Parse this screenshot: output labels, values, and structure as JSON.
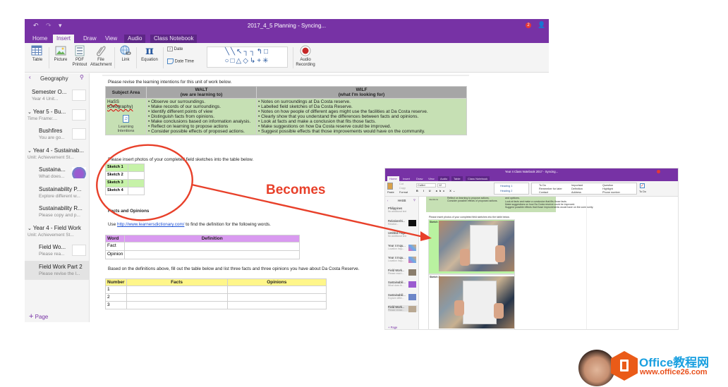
{
  "window": {
    "title": "2017_4_5 Planning - Syncing...",
    "quick_access": [
      "undo-icon",
      "redo-icon",
      "customize-icon"
    ],
    "notification_count": "2"
  },
  "tabs": [
    {
      "label": "Home",
      "active": false
    },
    {
      "label": "Insert",
      "active": true
    },
    {
      "label": "Draw",
      "active": false
    },
    {
      "label": "View",
      "active": false
    },
    {
      "label": "Audio",
      "active": false
    },
    {
      "label": "Class Notebook",
      "active": false
    }
  ],
  "ribbon": {
    "table": "Table",
    "picture": "Picture",
    "pdf_printout": "PDF Printout",
    "file_attachment": "File Attachment",
    "link": "Link",
    "equation": "Equation",
    "date": "Date",
    "date_time": "Date  Time",
    "shapes_row1": "╲╲↖┐┐↰□",
    "shapes_row2": "○□△◇↳+✳",
    "audio_recording": "Audio Recording"
  },
  "sidebar": {
    "section": "Geography",
    "items": [
      {
        "title": "Semester O...",
        "sub": "Year 4  Unit...",
        "level": 0,
        "thumb": true
      },
      {
        "title": "Year 5 - Bu...",
        "sub": "Time Frame:...",
        "level": 0,
        "group": true,
        "thumb": true
      },
      {
        "title": "Bushfires",
        "sub": "You are go...",
        "level": 1,
        "thumb": true
      },
      {
        "title": "Year 4 - Sustainab...",
        "sub": "Unit:  Achievement St...",
        "level": 0,
        "group": true
      },
      {
        "title": "Sustaina...",
        "sub": "What does...",
        "level": 1,
        "thumb": true
      },
      {
        "title": "Sustainability P...",
        "sub": "Explore different w...",
        "level": 1
      },
      {
        "title": "Sustainability R...",
        "sub": "Please copy and p...",
        "level": 1
      },
      {
        "title": "Year 4 - Field Work",
        "sub": "Unit:  Achievement St...",
        "level": 0,
        "group": true
      },
      {
        "title": "Field Wo...",
        "sub": "Please rea...",
        "level": 1,
        "thumb": true
      },
      {
        "title": "Field Work Part 2",
        "sub": "Please revise the l...",
        "level": 1,
        "selected": true
      }
    ],
    "add_page": "Page"
  },
  "page": {
    "intro": "Please revise the learning intentions for this unit of work below.",
    "learning_table": {
      "headers": [
        "Subject Area",
        "WALT",
        "(we are learning to)",
        "WILF",
        "(what I'm looking for)"
      ],
      "subject": "HaSS (Geography)",
      "attachment_label": "Learning Intentions",
      "walt": [
        "Observe our surroundings.",
        "Make records of our surroundings.",
        "Identify different points of view",
        "Distinguish facts from opinions.",
        "Make conclusions based on information analysis.",
        "Reflect on learning to propose actions",
        "Consider possible effects of proposed actions."
      ],
      "wilf": [
        "Notes on surroundings at Da Costa reserve.",
        "Labelled field sketches of Da Costa Reserve.",
        "Notes on how people of different ages might use the facilities at Da Costa reserve.",
        "Clearly show that you understand  the differences between facts and opinions.",
        "Look at facts and make a conclusion that fits those facts.",
        "Make suggestions on how Da Costa reserve could be improved.",
        "Suggest possible effects that those improvements would have on the community."
      ]
    },
    "sketch_intro": "Please insert photos of your completed field sketches into the table below.",
    "sketches": [
      "Sketch 1",
      "Sketch 2",
      "Sketch 3",
      "Sketch 4"
    ],
    "facts_heading": "Facts and Opinions",
    "use_prefix": "Use ",
    "link": "http://www.learnersdictionary.com/",
    "use_suffix": " to find the definition for the following words.",
    "definition_table": {
      "headers": [
        "Word",
        "Definition"
      ],
      "rows": [
        "Fact",
        "Opinion"
      ]
    },
    "based_on": "Based on the definitions above, fill out the table below and list  three facts and three opinions you have about Da Costa Reserve.",
    "facts_table": {
      "headers": [
        "Number",
        "Facts",
        "Opinions"
      ],
      "rows": [
        "1",
        "2",
        "3"
      ]
    }
  },
  "annotation": {
    "label": "Becomes",
    "color": "#e8402a"
  },
  "mini_window": {
    "title": "Year 4 Class Notebook 2017 - Syncing...",
    "tabs": [
      "Home",
      "Insert",
      "Draw",
      "View",
      "Audio",
      "Table",
      "Class Notebook"
    ],
    "ribbon": {
      "paste": "Paste",
      "cut": "Cut",
      "copy": "Copy",
      "format": "Format",
      "font": "Calibri",
      "size": "12",
      "heading1": "Heading 1",
      "heading2": "Heading 2",
      "tags_col1": [
        "To Do",
        "Remember for later",
        "Contact"
      ],
      "tags_col2": [
        "Important",
        "Definition",
        "Address"
      ],
      "tags_col3": [
        "Question",
        "Highlight",
        "Phone number"
      ],
      "todo": "To Do"
    },
    "sidebar": {
      "section": "HASS",
      "items": [
        {
          "title": "Philippines",
          "sub": "No additional text"
        },
        {
          "title": "Relationshi...",
          "sub": "Relation..."
        },
        {
          "title": "Untitled Page",
          "sub": "No additional text"
        },
        {
          "title": "Year 4 Inqu...",
          "sub": "Location Inqu..."
        },
        {
          "title": "Year 4 Inqu...",
          "sub": "Location Inqu..."
        },
        {
          "title": "Field Work...",
          "sub": "Please read t..."
        },
        {
          "title": "Sustainabili...",
          "sub": "What does th..."
        },
        {
          "title": "Sustainabili...",
          "sub": "Explore differ..."
        },
        {
          "title": "Field Work...",
          "sub": "Please revise..."
        }
      ],
      "add_page": "Page"
    },
    "page": {
      "walt_tail": [
        "Reflect on learning to propose actions.",
        "Consider possible effects of proposed actions."
      ],
      "wilf_tail": [
        "and opinions.",
        "Look at facts and make a conclusion that fits those facts.",
        "Make suggestions on how Da Costa reserve could be improved.",
        "Suggest possible effects that those improvements would have on the community."
      ],
      "intentions_label": "Intentions",
      "sketch_intro": "Please insert photos of your completed field sketches into the table below.",
      "sketches": [
        "Sketch 1",
        "Sketch 2"
      ]
    }
  },
  "watermark": {
    "brand": "Office教程网",
    "url": "www.office26.com"
  }
}
